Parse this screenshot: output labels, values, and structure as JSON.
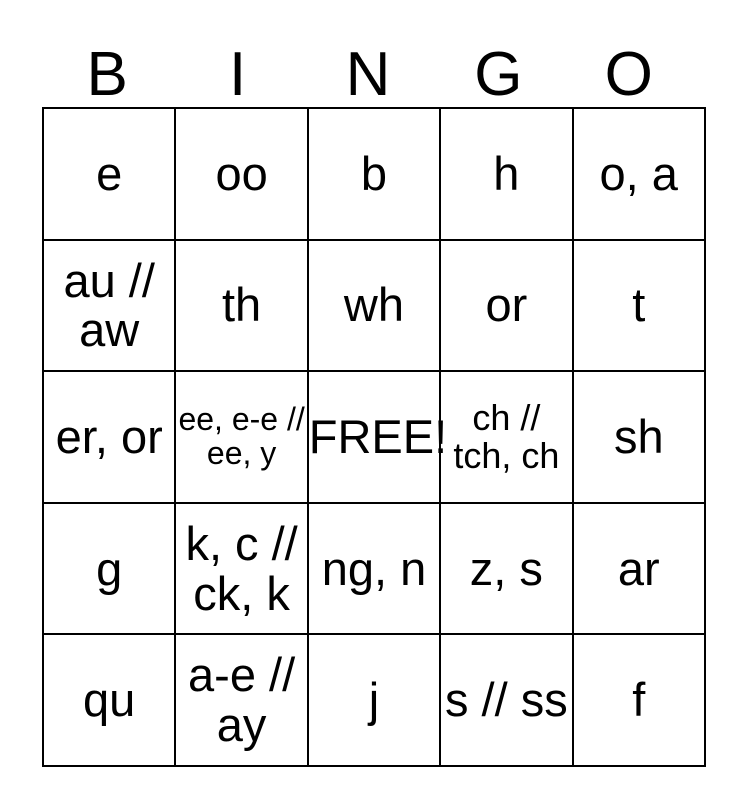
{
  "card": {
    "title": "BINGO",
    "header_letters": [
      "B",
      "I",
      "N",
      "G",
      "O"
    ],
    "free_space_label": "FREE!",
    "free_space_position": {
      "row": 3,
      "column": 3
    },
    "grid_size": "5x5",
    "colors": {
      "background": "#ffffff",
      "text": "#000000",
      "border": "#000000"
    },
    "rows": [
      {
        "cells": [
          {
            "text": "e",
            "size": "normal"
          },
          {
            "text": "oo",
            "size": "normal"
          },
          {
            "text": "b",
            "size": "normal"
          },
          {
            "text": "h",
            "size": "normal"
          },
          {
            "text": "o, a",
            "size": "normal"
          }
        ]
      },
      {
        "cells": [
          {
            "text": "au // aw",
            "size": "normal"
          },
          {
            "text": "th",
            "size": "normal"
          },
          {
            "text": "wh",
            "size": "normal"
          },
          {
            "text": "or",
            "size": "normal"
          },
          {
            "text": "t",
            "size": "normal"
          }
        ]
      },
      {
        "cells": [
          {
            "text": "er, or",
            "size": "normal"
          },
          {
            "text": "ee, e-e // ee, y",
            "size": "small"
          },
          {
            "text": "FREE!",
            "size": "normal"
          },
          {
            "text": "ch // tch, ch",
            "size": "medium"
          },
          {
            "text": "sh",
            "size": "normal"
          }
        ]
      },
      {
        "cells": [
          {
            "text": "g",
            "size": "normal"
          },
          {
            "text": "k, c // ck, k",
            "size": "normal"
          },
          {
            "text": "ng, n",
            "size": "normal"
          },
          {
            "text": "z, s",
            "size": "normal"
          },
          {
            "text": "ar",
            "size": "normal"
          }
        ]
      },
      {
        "cells": [
          {
            "text": "qu",
            "size": "normal"
          },
          {
            "text": "a-e // ay",
            "size": "normal"
          },
          {
            "text": "j",
            "size": "normal"
          },
          {
            "text": "s // ss",
            "size": "normal"
          },
          {
            "text": "f",
            "size": "normal"
          }
        ]
      }
    ]
  }
}
